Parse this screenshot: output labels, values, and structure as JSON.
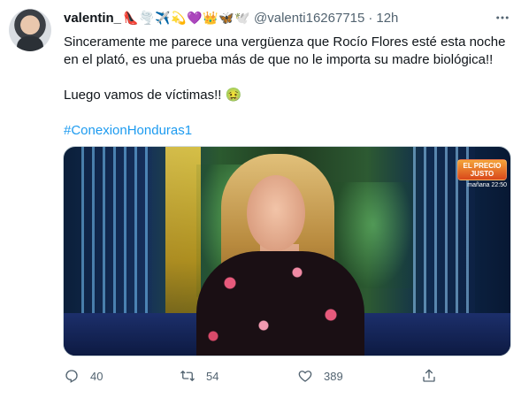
{
  "tweet": {
    "author": {
      "display_name": "valentin_",
      "emojis": [
        "👠",
        "🌪️",
        "✈️",
        "💫",
        "💜",
        "👑",
        "🦋",
        "🕊️"
      ],
      "handle": "@valenti16267715",
      "time": "12h"
    },
    "text": {
      "paragraph1": "Sinceramente me parece una vergüenza que Rocío Flores esté esta noche en el plató, es una prueba más de que no le importa su madre biológica!!",
      "paragraph2": "Luego vamos de víctimas!! 🤢",
      "hashtag": "#ConexionHonduras1"
    },
    "media": {
      "badge_logo": "EL PRECIO JUSTO",
      "badge_sub": "mañana 22:50"
    },
    "actions": {
      "reply_count": "40",
      "retweet_count": "54",
      "like_count": "389"
    },
    "colors": {
      "hashtag": "#1d9bf0",
      "secondary_text": "#536471",
      "primary_text": "#0f1419"
    }
  }
}
